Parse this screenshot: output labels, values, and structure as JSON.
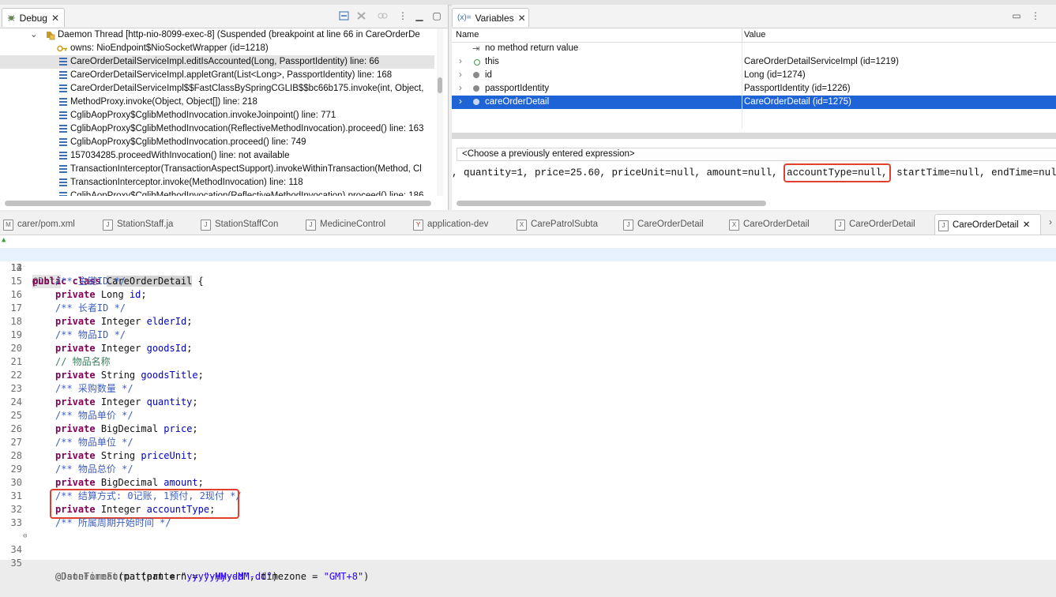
{
  "debug": {
    "tab_label": "Debug",
    "thread_label": "Daemon Thread [http-nio-8099-exec-8] (Suspended (breakpoint at line 66 in CareOrderDe",
    "owns_label": "owns: NioEndpoint$NioSocketWrapper  (id=1218)",
    "frames": [
      "CareOrderDetailServiceImpl.editIsAccounted(Long, PassportIdentity) line: 66",
      "CareOrderDetailServiceImpl.appletGrant(List<Long>, PassportIdentity) line: 168",
      "CareOrderDetailServiceImpl$$FastClassBySpringCGLIB$$bc66b175.invoke(int, Object,",
      "MethodProxy.invoke(Object, Object[]) line: 218",
      "CglibAopProxy$CglibMethodInvocation.invokeJoinpoint() line: 771",
      "CglibAopProxy$CglibMethodInvocation(ReflectiveMethodInvocation).proceed() line: 163",
      "CglibAopProxy$CglibMethodInvocation.proceed() line: 749",
      "157034285.proceedWithInvocation() line: not available",
      "TransactionInterceptor(TransactionAspectSupport).invokeWithinTransaction(Method, Cl",
      "TransactionInterceptor.invoke(MethodInvocation) line: 118",
      "CglibAopProxy$CglibMethodInvocation(ReflectiveMethodInvocation).proceed() line: 186"
    ]
  },
  "variables": {
    "tab_label": "Variables",
    "tab_prefix": "(x)=",
    "col_name": "Name",
    "col_value": "Value",
    "rows": [
      {
        "name": "no method return value",
        "value": ""
      },
      {
        "name": "this",
        "value": "CareOrderDetailServiceImpl  (id=1219)"
      },
      {
        "name": "id",
        "value": "Long  (id=1274)"
      },
      {
        "name": "passportIdentity",
        "value": "PassportIdentity  (id=1226)"
      },
      {
        "name": "careOrderDetail",
        "value": "CareOrderDetail  (id=1275)"
      }
    ],
    "expression_placeholder": "<Choose a previously entered expression>",
    "detail_before": ", quantity=1, price=25.60, priceUnit=null, amount=null, ",
    "detail_highlight": "accountType=null,",
    "detail_after": " startTime=null, endTime=null, b"
  },
  "editor": {
    "tabs": [
      {
        "label": "carer/pom.xml",
        "icon": "M"
      },
      {
        "label": "StationStaff.ja",
        "icon": "J"
      },
      {
        "label": "StationStaffCon",
        "icon": "J"
      },
      {
        "label": "MedicineControl",
        "icon": "J"
      },
      {
        "label": "application-dev",
        "icon": "Y"
      },
      {
        "label": "CarePatrolSubta",
        "icon": "X"
      },
      {
        "label": "CareOrderDetail",
        "icon": "J"
      },
      {
        "label": "CareOrderDetail",
        "icon": "X"
      },
      {
        "label": "CareOrderDetail",
        "icon": "J"
      },
      {
        "label": "CareOrderDetail",
        "icon": "J"
      }
    ],
    "line_numbers": [
      "12",
      "13",
      "14",
      "15",
      "16",
      "17",
      "18",
      "19",
      "20",
      "21",
      "22",
      "23",
      "24",
      "25",
      "26",
      "27",
      "28",
      "29",
      "30",
      "31",
      "32",
      "33",
      "34",
      "35"
    ],
    "code": {
      "l12_ann": "@Data",
      "l13_kw1": "public",
      "l13_kw2": "class",
      "l13_name": "CareOrderDetail",
      "l13_brace": " {",
      "c15": "/** 主键ID */",
      "c17": "/** 长者ID */",
      "c19": "/** 物品ID */",
      "c21": "// 物品名称",
      "c23": "/** 采购数量 */",
      "c25": "/** 物品单价 */",
      "c27": "/** 物品单位 */",
      "c29": "/** 物品总价 */",
      "c31": "/** 结算方式: 0记账, 1预付, 2现付 */",
      "c33": "/** 所属周期开始时间 */",
      "private_kw": "private",
      "f16_type": "Long ",
      "f16_name": "id",
      "f18_type": "Integer ",
      "f18_name": "elderId",
      "f20_type": "Integer ",
      "f20_name": "goodsId",
      "f22_type": "String ",
      "f22_name": "goodsTitle",
      "f24_type": "Integer ",
      "f24_name": "quantity",
      "f26_type": "BigDecimal ",
      "f26_name": "price",
      "f28_type": "String ",
      "f28_name": "priceUnit",
      "f30_type": "BigDecimal ",
      "f30_name": "amount",
      "f32_type": "Integer ",
      "f32_name": "accountType",
      "semicolon": ";",
      "l34_ann": "@DateTimeFormat",
      "l34_mid": "(pattern = ",
      "l34_str": "\"yyyy-MM-dd\"",
      "l34_end": ")",
      "l35_ann": "@JsonFormat",
      "l35_mid": "(pattern = ",
      "l35_str": "\"yyyy-MM-dd\"",
      "l35_mid2": ", timezone = ",
      "l35_str2": "\"GMT+8\"",
      "l35_end": ")"
    }
  },
  "colors": {
    "selection": "#1f64d6",
    "highlight_box": "#e0412e",
    "keyword": "#7f0055",
    "comment": "#3f5fbf",
    "field": "#0000c0"
  }
}
